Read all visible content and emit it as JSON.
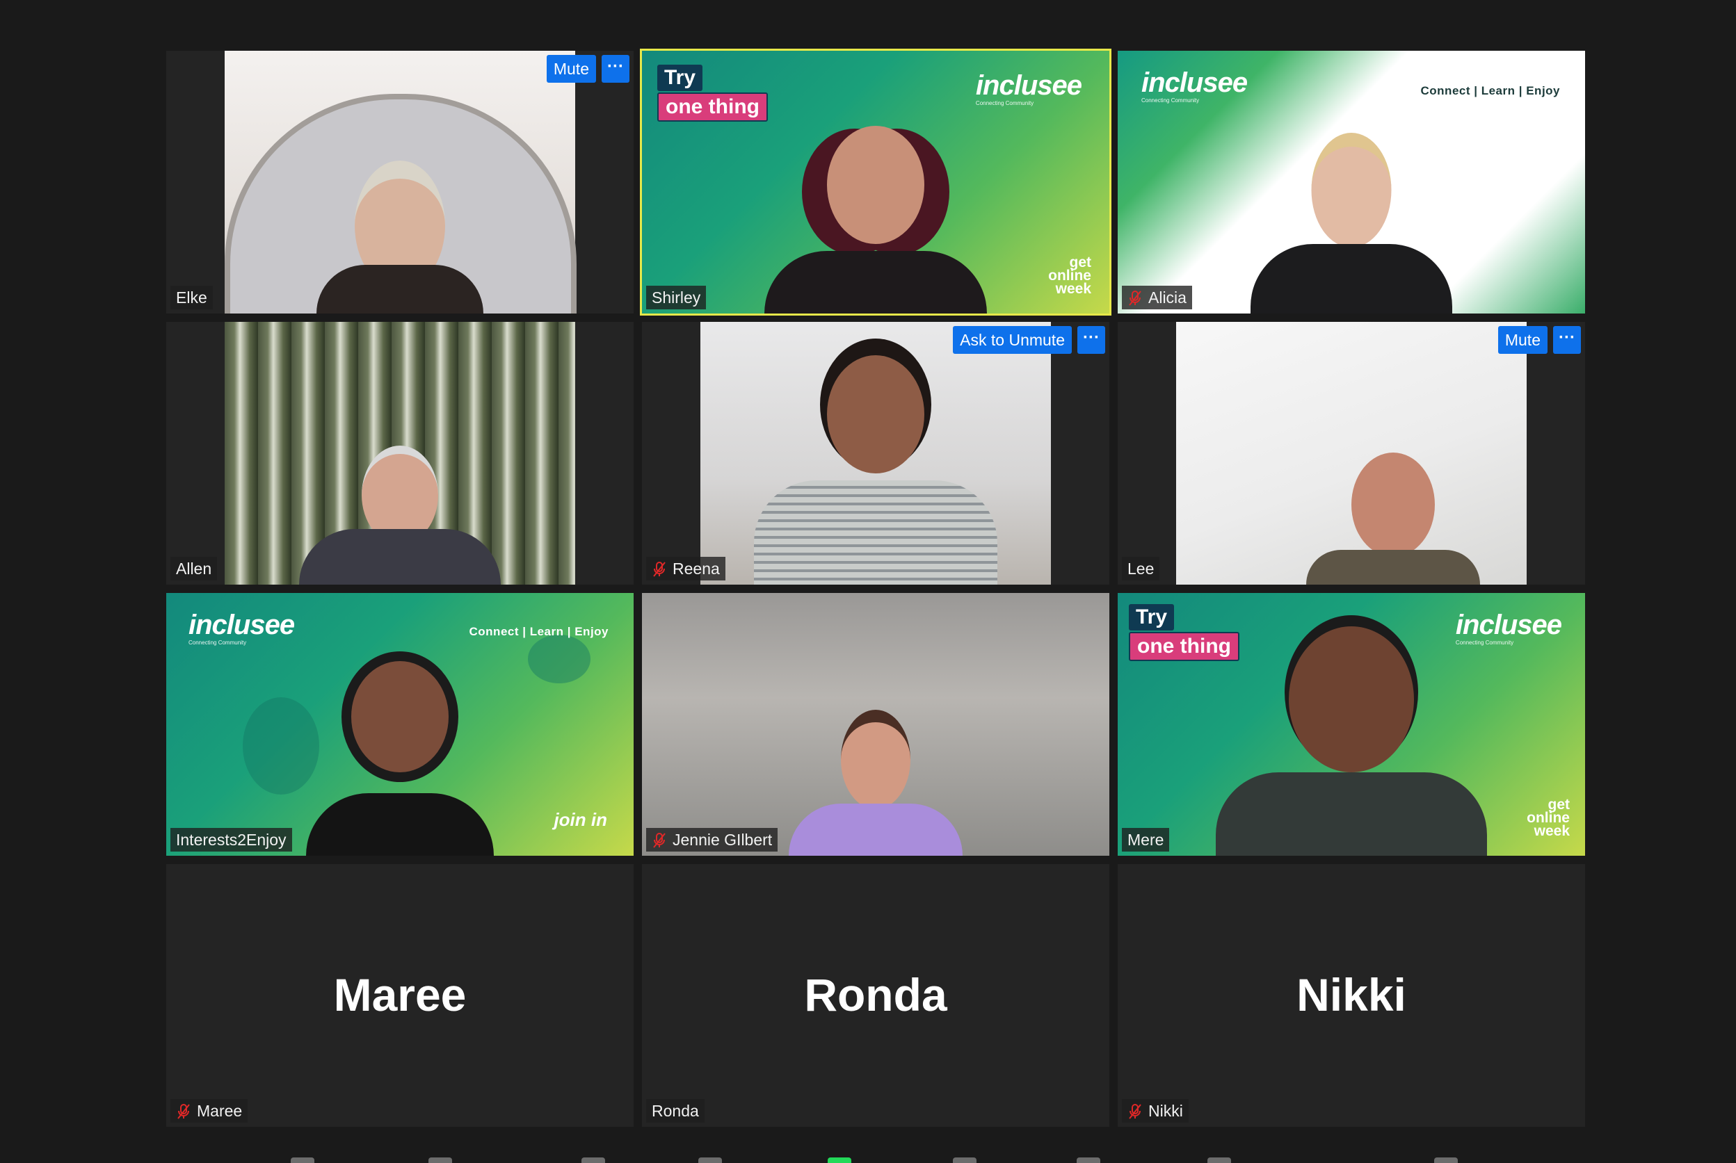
{
  "participants": [
    {
      "name": "Elke",
      "muted": false,
      "button": "Mute"
    },
    {
      "name": "Shirley",
      "muted": false,
      "active_speaker": true
    },
    {
      "name": "Alicia",
      "muted": true
    },
    {
      "name": "Allen",
      "muted": false
    },
    {
      "name": "Reena",
      "muted": true,
      "button": "Ask to Unmute"
    },
    {
      "name": "Lee",
      "muted": false,
      "button": "Mute"
    },
    {
      "name": "Interests2Enjoy",
      "muted": false
    },
    {
      "name": "Jennie GIlbert",
      "muted": true
    },
    {
      "name": "Mere",
      "muted": false
    },
    {
      "name": "Maree",
      "muted": true,
      "video_off": true
    },
    {
      "name": "Ronda",
      "muted": false,
      "video_off": true
    },
    {
      "name": "Nikki",
      "muted": true,
      "video_off": true
    }
  ],
  "more_button_label": "···",
  "branding": {
    "logo": "inclusee",
    "logo_sub": "Connecting Community",
    "tagline": "Connect | Learn | Enjoy",
    "try": "Try",
    "one_thing": "one thing",
    "gow_line1": "get",
    "gow_line2": "online",
    "gow_line3": "week",
    "join_in": "join in"
  },
  "colors": {
    "accent_blue": "#0e71eb",
    "active_outline": "#e6e84a",
    "mic_off_red": "#e02828",
    "brand_pink": "#d93d7b",
    "brand_navy": "#0f3a52",
    "background": "#1a1a1a"
  }
}
